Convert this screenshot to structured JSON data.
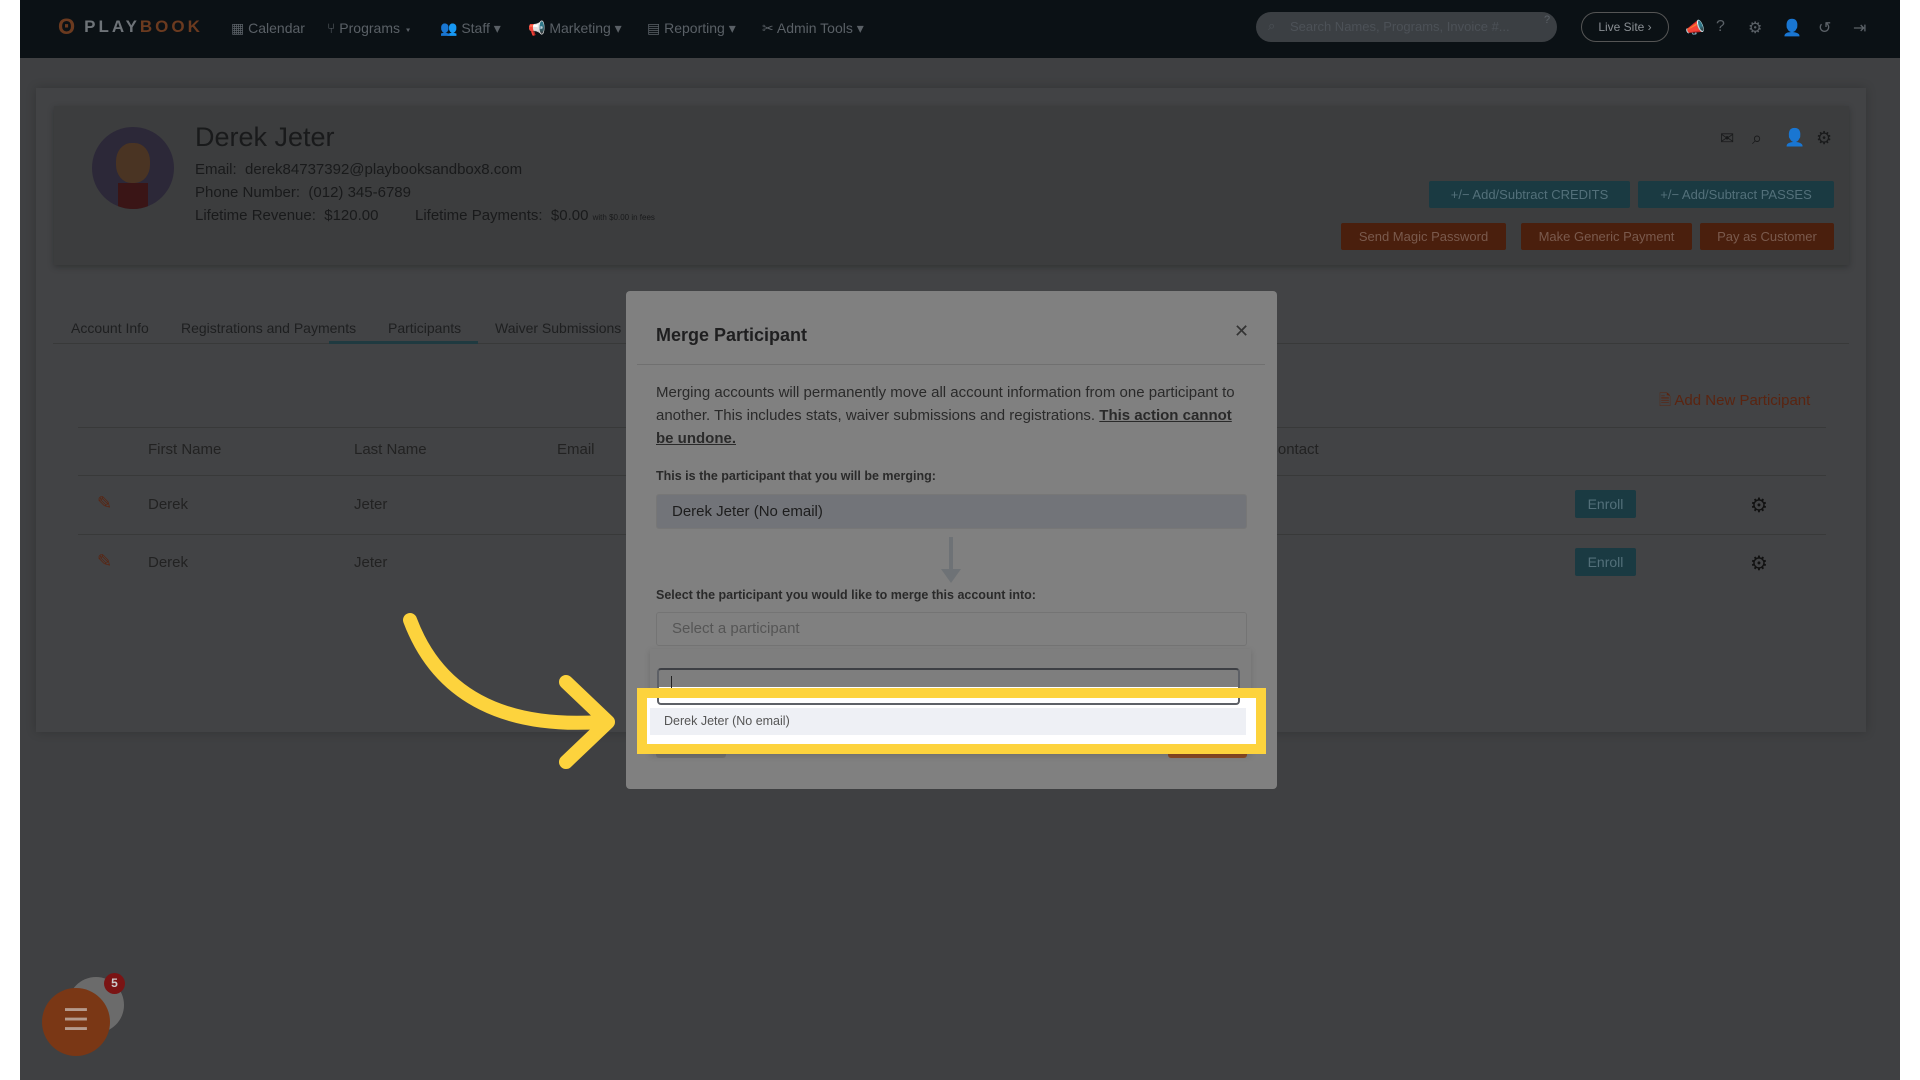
{
  "nav": {
    "logo": "PLAYBOOK",
    "logo_a": "PLAY",
    "logo_b": "BOOK",
    "items": [
      "Calendar",
      "Programs",
      "Staff",
      "Marketing",
      "Reporting",
      "Admin Tools"
    ],
    "search_placeholder": "Search Names, Programs, Invoice #...",
    "live_site": "Live Site ›"
  },
  "profile": {
    "name": "Derek Jeter",
    "email_label": "Email:",
    "email": "derek84737392@playbooksandbox8.com",
    "phone_label": "Phone Number:",
    "phone": "(012) 345-6789",
    "revenue_label": "Lifetime Revenue:",
    "revenue": "$120.00",
    "payments_label": "Lifetime Payments:",
    "payments": "$0.00",
    "fees_note": "with $0.00 in fees"
  },
  "actions": {
    "credits": "+/−  Add/Subtract CREDITS",
    "passes": "+/−  Add/Subtract PASSES",
    "magic": "Send Magic Password",
    "generic": "Make Generic Payment",
    "pay": "Pay as Customer"
  },
  "tabs": [
    "Account Info",
    "Registrations and Payments",
    "Participants",
    "Waiver Submissions"
  ],
  "active_tab": "Participants",
  "participants": {
    "add_label": "Add New Participant",
    "columns": [
      "First Name",
      "Last Name",
      "Email",
      "Emergency Contact"
    ],
    "rows": [
      {
        "first": "Derek",
        "last": "Jeter",
        "enroll": "Enroll"
      },
      {
        "first": "Derek",
        "last": "Jeter",
        "enroll": "Enroll"
      }
    ]
  },
  "modal": {
    "title": "Merge Participant",
    "intro": "Merging accounts will permanently move all account information from one participant to another. This includes stats, waiver submissions and registrations.",
    "warning": "This action cannot be undone.",
    "source_label": "This is the participant that you will be merging:",
    "source_value": "Derek Jeter (No email)",
    "target_label": "Select the participant you would like to merge this account into:",
    "target_placeholder": "Select a participant",
    "search_value": "",
    "options": [
      "Derek Jeter (No email)"
    ]
  },
  "chat": {
    "badge": "5"
  },
  "colors": {
    "highlight": "#fdd33d",
    "accent_orange": "#d2541c",
    "accent_teal": "#1f6f80"
  }
}
